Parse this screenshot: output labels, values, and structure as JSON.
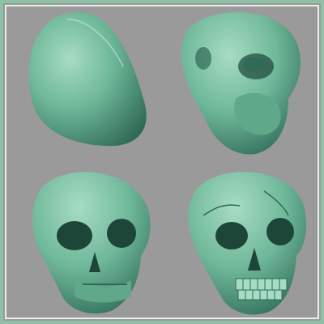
{
  "colors": {
    "background": "#9a9a9a",
    "frame": "#8fbfa6",
    "frame_inner": "#e6efe9",
    "clay": "#6fb89a",
    "clay_light": "#a7dcc4",
    "clay_shadow": "#2f6a55",
    "clay_deep": "#1d4538"
  },
  "stages": [
    {
      "id": "stage-1-blockout"
    },
    {
      "id": "stage-2-primary-forms"
    },
    {
      "id": "stage-3-secondary-forms"
    },
    {
      "id": "stage-4-detailed-skull"
    }
  ]
}
